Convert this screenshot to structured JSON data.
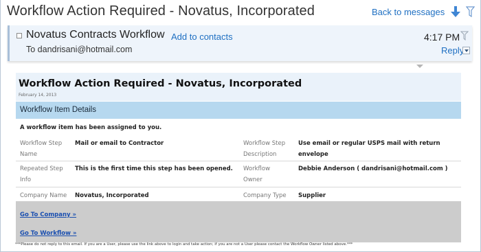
{
  "toolbar": {
    "subject": "Workflow Action Required - Novatus, Incorporated",
    "back_label": "Back to messages"
  },
  "header": {
    "sender": "Novatus Contracts Workflow",
    "add_contacts": "Add to contacts",
    "to": "To dandrisani@hotmail.com",
    "time": "4:17 PM",
    "reply": "Reply"
  },
  "email": {
    "title": "Workflow Action Required - Novatus, Incorporated",
    "date": "February 14, 2013",
    "section_title": "Workflow Item Details",
    "intro": "A workflow item has been assigned to you.",
    "rows": [
      {
        "label1_a": "Workflow Step",
        "label1_b": "Name",
        "value1": "Mail or email to Contractor",
        "label2_a": "Workflow Step",
        "label2_b": "Description",
        "value2": "Use email or regular USPS mail with return envelope"
      },
      {
        "label1_a": "Repeated Step",
        "label1_b": "Info",
        "value1": "This is the first time this step has been opened.",
        "label2_a": "Workflow",
        "label2_b": "Owner",
        "value2": "Debbie Anderson ( dandrisani@hotmail.com )"
      },
      {
        "label1_a": "Company Name",
        "value1": "Novatus, Incorporated",
        "label2_a": "Company Type",
        "value2": "Supplier"
      }
    ],
    "link_company": "Go To Company »",
    "link_workflow": "Go To Workflow »",
    "footer": "***Please do not reply to this email. If you are a User, please use the link above to login and take action; if you are not a User please contact the Workflow Owner listed above.***"
  },
  "colors": {
    "link": "#1e6fc2",
    "title_band": "#eaf2fa",
    "details_band": "#b6d8ef",
    "gray_area": "#cccccc"
  }
}
